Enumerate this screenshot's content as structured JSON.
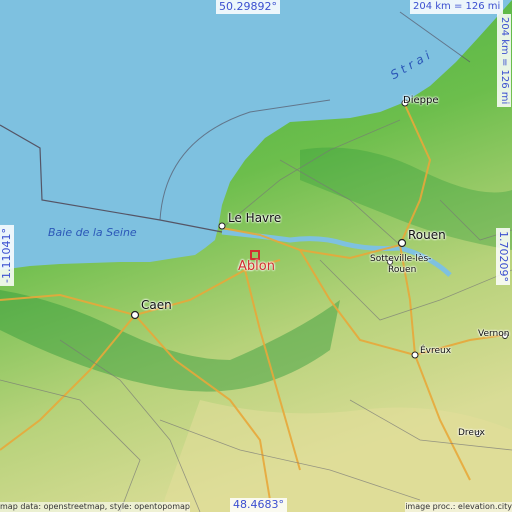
{
  "map": {
    "coords": {
      "north": "50.29892°",
      "south": "48.4683°",
      "west": "-1.11041°",
      "east": "1.70209°"
    },
    "scale_top": "204 km = 126 mi",
    "scale_right": "204 km = 126 mi",
    "highlight": {
      "name": "Ablon",
      "color": "#d03030"
    },
    "water_labels": {
      "bay": "Baie de la Seine",
      "strait": "S t r a i"
    },
    "cities": {
      "dieppe": "Dieppe",
      "le_havre": "Le Havre",
      "rouen": "Rouen",
      "sotteville_line1": "Sotteville-lès-",
      "sotteville_line2": "Rouen",
      "caen": "Caen",
      "evreux": "Évreux",
      "vernon": "Vernon",
      "dreux": "Dreux"
    },
    "attribution_left": "map data: openstreetmap, style: opentopomap",
    "attribution_right": "image proc.: elevation.city",
    "colors": {
      "sea": "#7ec1e0",
      "lowland": "#3fae3f",
      "upland": "#c9d98a",
      "roads": "#e8a83a",
      "coordinate_text": "#3b4fd0"
    }
  }
}
